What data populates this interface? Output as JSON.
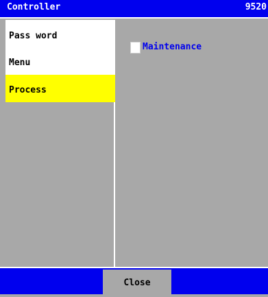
{
  "window": {
    "title": "Controller",
    "code": "9520"
  },
  "sidebar": {
    "items": [
      {
        "label": "Pass word",
        "selected": false
      },
      {
        "label": "Menu",
        "selected": false
      },
      {
        "label": "Process",
        "selected": true
      }
    ]
  },
  "main": {
    "options": [
      {
        "label": "Maintenance",
        "checked": false
      }
    ]
  },
  "footer": {
    "close_label": "Close"
  },
  "colors": {
    "title_bar": "#0000ee",
    "background": "#a8a8a8",
    "selected_item": "#ffff00",
    "option_text": "#0000ee"
  }
}
